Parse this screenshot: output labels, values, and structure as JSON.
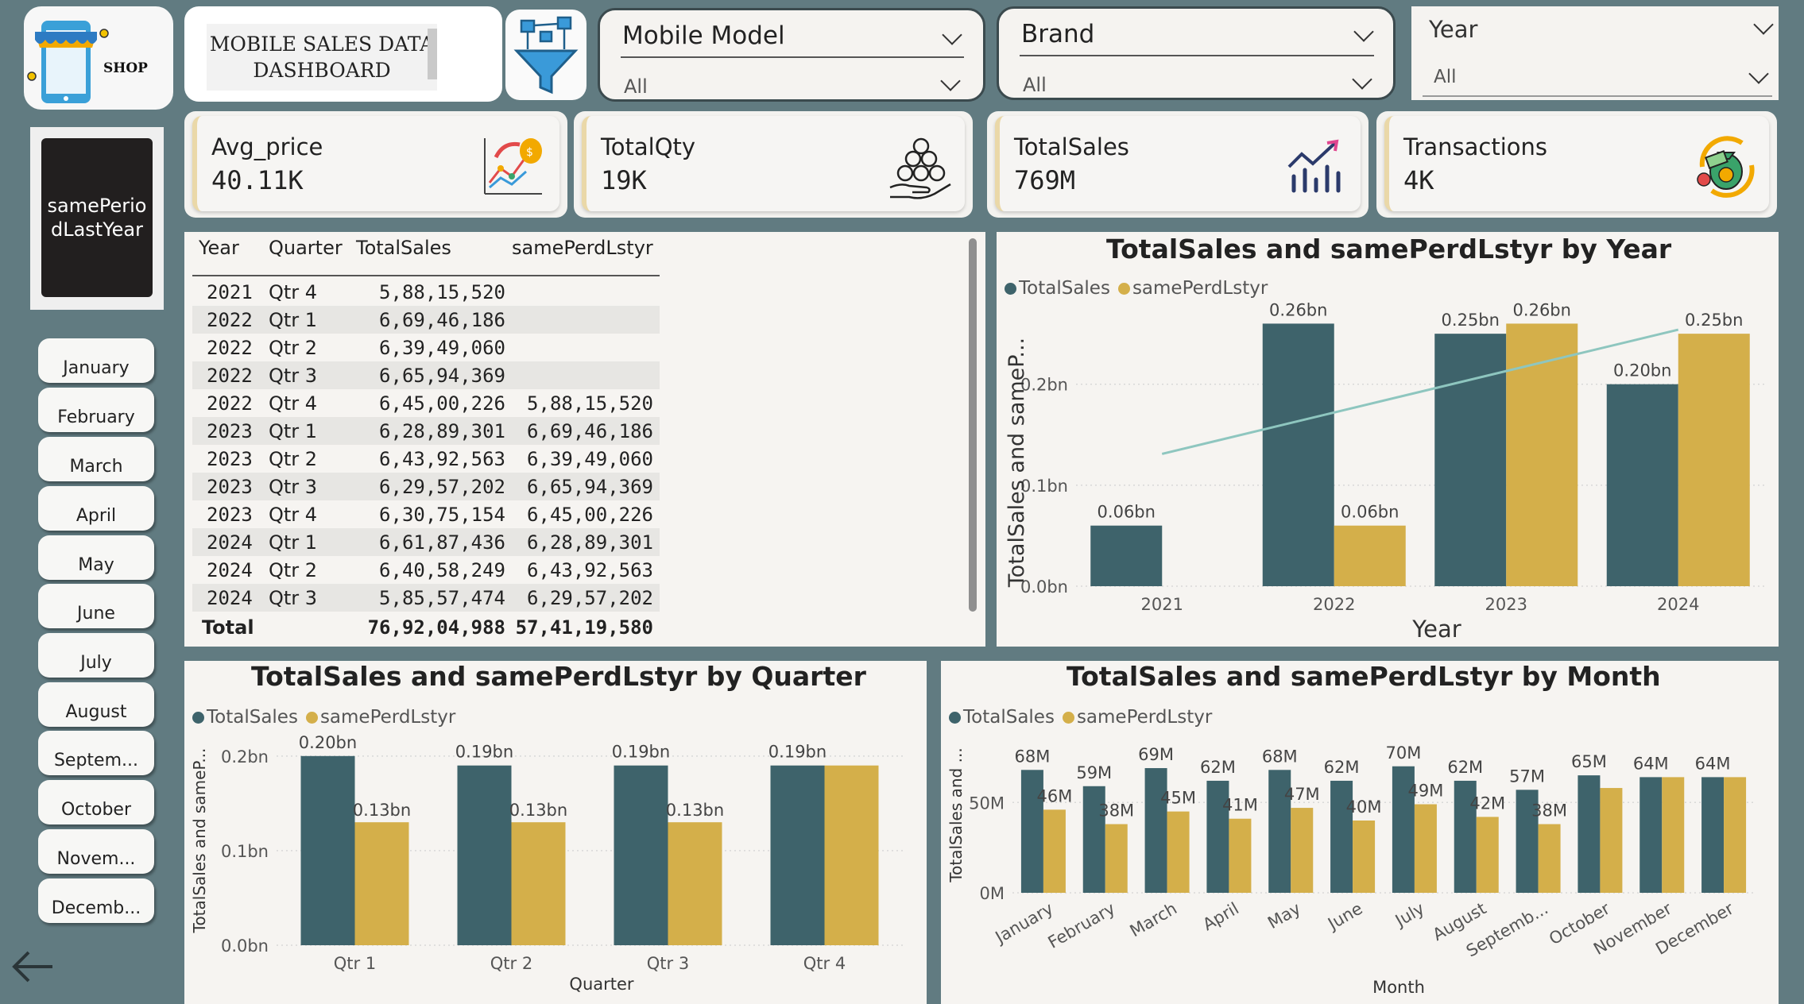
{
  "header": {
    "title": "MOBILE SALES DATA DASHBOARD",
    "shop_label": "SHOP"
  },
  "slicers": {
    "model": {
      "label": "Mobile Model",
      "value": "All"
    },
    "brand": {
      "label": "Brand",
      "value": "All"
    },
    "year": {
      "label": "Year",
      "value": "All"
    }
  },
  "kpis": [
    {
      "label": "Avg_price",
      "value": "40.11K",
      "icon": "price-chart-icon"
    },
    {
      "label": "TotalQty",
      "value": "19K",
      "icon": "coin-stack-icon"
    },
    {
      "label": "TotalSales",
      "value": "769M",
      "icon": "sales-growth-icon"
    },
    {
      "label": "Transactions",
      "value": "4K",
      "icon": "money-bag-icon"
    }
  ],
  "sidebar": {
    "period_button": "samePeriodLastYear",
    "months": [
      "January",
      "February",
      "March",
      "April",
      "May",
      "June",
      "July",
      "August",
      "Septem...",
      "October",
      "Novem...",
      "Decemb..."
    ]
  },
  "table": {
    "columns": [
      "Year",
      "Quarter",
      "TotalSales",
      "samePerdLstyr"
    ],
    "rows": [
      [
        "2021",
        "Qtr 4",
        "5,88,15,520",
        ""
      ],
      [
        "2022",
        "Qtr 1",
        "6,69,46,186",
        ""
      ],
      [
        "2022",
        "Qtr 2",
        "6,39,49,060",
        ""
      ],
      [
        "2022",
        "Qtr 3",
        "6,65,94,369",
        ""
      ],
      [
        "2022",
        "Qtr 4",
        "6,45,00,226",
        "5,88,15,520"
      ],
      [
        "2023",
        "Qtr 1",
        "6,28,89,301",
        "6,69,46,186"
      ],
      [
        "2023",
        "Qtr 2",
        "6,43,92,563",
        "6,39,49,060"
      ],
      [
        "2023",
        "Qtr 3",
        "6,29,57,202",
        "6,65,94,369"
      ],
      [
        "2023",
        "Qtr 4",
        "6,30,75,154",
        "6,45,00,226"
      ],
      [
        "2024",
        "Qtr 1",
        "6,61,87,436",
        "6,28,89,301"
      ],
      [
        "2024",
        "Qtr 2",
        "6,40,58,249",
        "6,43,92,563"
      ],
      [
        "2024",
        "Qtr 3",
        "5,85,57,474",
        "6,29,57,202"
      ]
    ],
    "total": [
      "Total",
      "",
      "76,92,04,988",
      "57,41,19,580"
    ]
  },
  "colors": {
    "totalsales": "#3e636b",
    "sameperd": "#d4af4a",
    "trend": "#8ec6bf"
  },
  "chart_data": [
    {
      "type": "bar",
      "title": "TotalSales and samePerdLstyr by Year",
      "categories": [
        "2021",
        "2022",
        "2023",
        "2024"
      ],
      "series": [
        {
          "name": "TotalSales",
          "values": [
            0.06,
            0.26,
            0.25,
            0.2
          ],
          "labels": [
            "0.06bn",
            "0.26bn",
            "0.25bn",
            "0.20bn"
          ]
        },
        {
          "name": "samePerdLstyr",
          "values": [
            null,
            0.06,
            0.26,
            0.25
          ],
          "labels": [
            "",
            "0.06bn",
            "0.26bn",
            "0.25bn"
          ]
        }
      ],
      "xlabel": "Year",
      "ylabel": "TotalSales and sameP...",
      "ylim": [
        0,
        0.28
      ],
      "yticks": [
        "0.0bn",
        "0.1bn",
        "0.2bn"
      ],
      "trend_line": true
    },
    {
      "type": "bar",
      "title": "TotalSales and samePerdLstyr by Quarter",
      "categories": [
        "Qtr 1",
        "Qtr 2",
        "Qtr 3",
        "Qtr 4"
      ],
      "series": [
        {
          "name": "TotalSales",
          "values": [
            0.2,
            0.19,
            0.19,
            0.19
          ],
          "labels": [
            "0.20bn",
            "0.19bn",
            "0.19bn",
            "0.19bn"
          ]
        },
        {
          "name": "samePerdLstyr",
          "values": [
            0.13,
            0.13,
            0.13,
            0.19
          ],
          "labels": [
            "0.13bn",
            "0.13bn",
            "0.13bn",
            ""
          ]
        }
      ],
      "xlabel": "Quarter",
      "ylabel": "TotalSales and sameP...",
      "ylim": [
        0,
        0.22
      ],
      "yticks": [
        "0.0bn",
        "0.1bn",
        "0.2bn"
      ]
    },
    {
      "type": "bar",
      "title": "TotalSales and samePerdLstyr by Month",
      "categories": [
        "January",
        "February",
        "March",
        "April",
        "May",
        "June",
        "July",
        "August",
        "Septemb...",
        "October",
        "November",
        "December"
      ],
      "series": [
        {
          "name": "TotalSales",
          "values": [
            68,
            59,
            69,
            62,
            68,
            62,
            70,
            62,
            57,
            65,
            64,
            64
          ],
          "labels": [
            "68M",
            "59M",
            "69M",
            "62M",
            "68M",
            "62M",
            "70M",
            "62M",
            "57M",
            "65M",
            "64M",
            "64M"
          ]
        },
        {
          "name": "samePerdLstyr",
          "values": [
            46,
            38,
            45,
            41,
            47,
            40,
            49,
            42,
            38,
            58,
            64,
            64
          ],
          "labels": [
            "46M",
            "38M",
            "45M",
            "41M",
            "47M",
            "40M",
            "49M",
            "42M",
            "38M",
            "",
            "",
            ""
          ]
        }
      ],
      "xlabel": "Month",
      "ylabel": "TotalSales and ...",
      "ylim": [
        0,
        80
      ],
      "yticks": [
        "0M",
        "50M"
      ]
    }
  ]
}
